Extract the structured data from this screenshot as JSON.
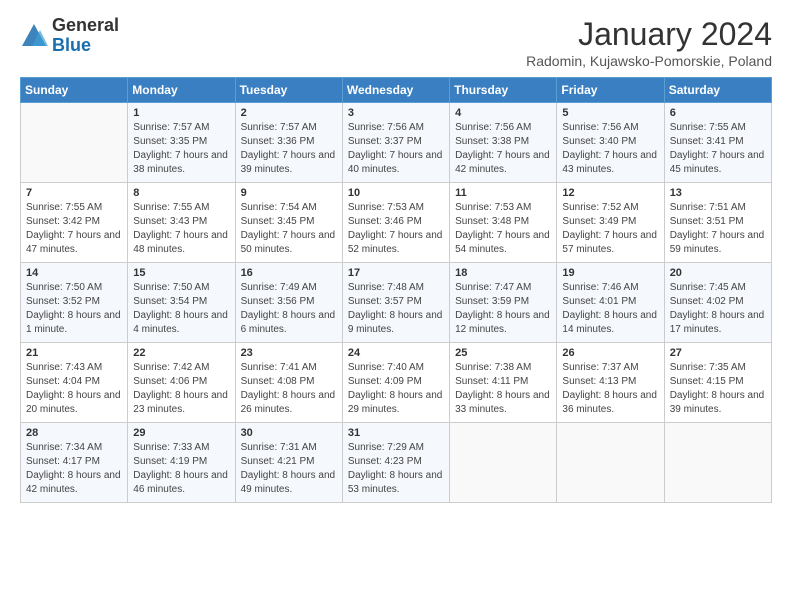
{
  "logo": {
    "general": "General",
    "blue": "Blue"
  },
  "header": {
    "month": "January 2024",
    "location": "Radomin, Kujawsko-Pomorskie, Poland"
  },
  "weekdays": [
    "Sunday",
    "Monday",
    "Tuesday",
    "Wednesday",
    "Thursday",
    "Friday",
    "Saturday"
  ],
  "weeks": [
    [
      {
        "day": "",
        "sunrise": "",
        "sunset": "",
        "daylight": ""
      },
      {
        "day": "1",
        "sunrise": "Sunrise: 7:57 AM",
        "sunset": "Sunset: 3:35 PM",
        "daylight": "Daylight: 7 hours and 38 minutes."
      },
      {
        "day": "2",
        "sunrise": "Sunrise: 7:57 AM",
        "sunset": "Sunset: 3:36 PM",
        "daylight": "Daylight: 7 hours and 39 minutes."
      },
      {
        "day": "3",
        "sunrise": "Sunrise: 7:56 AM",
        "sunset": "Sunset: 3:37 PM",
        "daylight": "Daylight: 7 hours and 40 minutes."
      },
      {
        "day": "4",
        "sunrise": "Sunrise: 7:56 AM",
        "sunset": "Sunset: 3:38 PM",
        "daylight": "Daylight: 7 hours and 42 minutes."
      },
      {
        "day": "5",
        "sunrise": "Sunrise: 7:56 AM",
        "sunset": "Sunset: 3:40 PM",
        "daylight": "Daylight: 7 hours and 43 minutes."
      },
      {
        "day": "6",
        "sunrise": "Sunrise: 7:55 AM",
        "sunset": "Sunset: 3:41 PM",
        "daylight": "Daylight: 7 hours and 45 minutes."
      }
    ],
    [
      {
        "day": "7",
        "sunrise": "Sunrise: 7:55 AM",
        "sunset": "Sunset: 3:42 PM",
        "daylight": "Daylight: 7 hours and 47 minutes."
      },
      {
        "day": "8",
        "sunrise": "Sunrise: 7:55 AM",
        "sunset": "Sunset: 3:43 PM",
        "daylight": "Daylight: 7 hours and 48 minutes."
      },
      {
        "day": "9",
        "sunrise": "Sunrise: 7:54 AM",
        "sunset": "Sunset: 3:45 PM",
        "daylight": "Daylight: 7 hours and 50 minutes."
      },
      {
        "day": "10",
        "sunrise": "Sunrise: 7:53 AM",
        "sunset": "Sunset: 3:46 PM",
        "daylight": "Daylight: 7 hours and 52 minutes."
      },
      {
        "day": "11",
        "sunrise": "Sunrise: 7:53 AM",
        "sunset": "Sunset: 3:48 PM",
        "daylight": "Daylight: 7 hours and 54 minutes."
      },
      {
        "day": "12",
        "sunrise": "Sunrise: 7:52 AM",
        "sunset": "Sunset: 3:49 PM",
        "daylight": "Daylight: 7 hours and 57 minutes."
      },
      {
        "day": "13",
        "sunrise": "Sunrise: 7:51 AM",
        "sunset": "Sunset: 3:51 PM",
        "daylight": "Daylight: 7 hours and 59 minutes."
      }
    ],
    [
      {
        "day": "14",
        "sunrise": "Sunrise: 7:50 AM",
        "sunset": "Sunset: 3:52 PM",
        "daylight": "Daylight: 8 hours and 1 minute."
      },
      {
        "day": "15",
        "sunrise": "Sunrise: 7:50 AM",
        "sunset": "Sunset: 3:54 PM",
        "daylight": "Daylight: 8 hours and 4 minutes."
      },
      {
        "day": "16",
        "sunrise": "Sunrise: 7:49 AM",
        "sunset": "Sunset: 3:56 PM",
        "daylight": "Daylight: 8 hours and 6 minutes."
      },
      {
        "day": "17",
        "sunrise": "Sunrise: 7:48 AM",
        "sunset": "Sunset: 3:57 PM",
        "daylight": "Daylight: 8 hours and 9 minutes."
      },
      {
        "day": "18",
        "sunrise": "Sunrise: 7:47 AM",
        "sunset": "Sunset: 3:59 PM",
        "daylight": "Daylight: 8 hours and 12 minutes."
      },
      {
        "day": "19",
        "sunrise": "Sunrise: 7:46 AM",
        "sunset": "Sunset: 4:01 PM",
        "daylight": "Daylight: 8 hours and 14 minutes."
      },
      {
        "day": "20",
        "sunrise": "Sunrise: 7:45 AM",
        "sunset": "Sunset: 4:02 PM",
        "daylight": "Daylight: 8 hours and 17 minutes."
      }
    ],
    [
      {
        "day": "21",
        "sunrise": "Sunrise: 7:43 AM",
        "sunset": "Sunset: 4:04 PM",
        "daylight": "Daylight: 8 hours and 20 minutes."
      },
      {
        "day": "22",
        "sunrise": "Sunrise: 7:42 AM",
        "sunset": "Sunset: 4:06 PM",
        "daylight": "Daylight: 8 hours and 23 minutes."
      },
      {
        "day": "23",
        "sunrise": "Sunrise: 7:41 AM",
        "sunset": "Sunset: 4:08 PM",
        "daylight": "Daylight: 8 hours and 26 minutes."
      },
      {
        "day": "24",
        "sunrise": "Sunrise: 7:40 AM",
        "sunset": "Sunset: 4:09 PM",
        "daylight": "Daylight: 8 hours and 29 minutes."
      },
      {
        "day": "25",
        "sunrise": "Sunrise: 7:38 AM",
        "sunset": "Sunset: 4:11 PM",
        "daylight": "Daylight: 8 hours and 33 minutes."
      },
      {
        "day": "26",
        "sunrise": "Sunrise: 7:37 AM",
        "sunset": "Sunset: 4:13 PM",
        "daylight": "Daylight: 8 hours and 36 minutes."
      },
      {
        "day": "27",
        "sunrise": "Sunrise: 7:35 AM",
        "sunset": "Sunset: 4:15 PM",
        "daylight": "Daylight: 8 hours and 39 minutes."
      }
    ],
    [
      {
        "day": "28",
        "sunrise": "Sunrise: 7:34 AM",
        "sunset": "Sunset: 4:17 PM",
        "daylight": "Daylight: 8 hours and 42 minutes."
      },
      {
        "day": "29",
        "sunrise": "Sunrise: 7:33 AM",
        "sunset": "Sunset: 4:19 PM",
        "daylight": "Daylight: 8 hours and 46 minutes."
      },
      {
        "day": "30",
        "sunrise": "Sunrise: 7:31 AM",
        "sunset": "Sunset: 4:21 PM",
        "daylight": "Daylight: 8 hours and 49 minutes."
      },
      {
        "day": "31",
        "sunrise": "Sunrise: 7:29 AM",
        "sunset": "Sunset: 4:23 PM",
        "daylight": "Daylight: 8 hours and 53 minutes."
      },
      {
        "day": "",
        "sunrise": "",
        "sunset": "",
        "daylight": ""
      },
      {
        "day": "",
        "sunrise": "",
        "sunset": "",
        "daylight": ""
      },
      {
        "day": "",
        "sunrise": "",
        "sunset": "",
        "daylight": ""
      }
    ]
  ]
}
